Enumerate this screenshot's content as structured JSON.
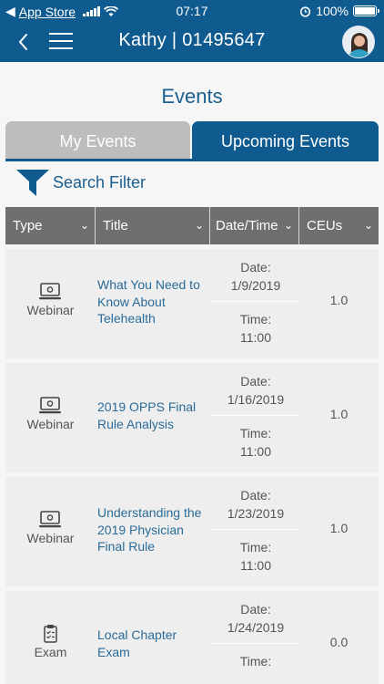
{
  "status_bar": {
    "carrier": "App Store",
    "time": "07:17",
    "battery": "100%"
  },
  "nav": {
    "title": "Kathy | 01495647"
  },
  "page": {
    "title": "Events"
  },
  "tabs": [
    {
      "label": "My Events",
      "active": false
    },
    {
      "label": "Upcoming Events",
      "active": true
    }
  ],
  "filter": {
    "label": "Search Filter"
  },
  "table": {
    "columns": [
      "Type",
      "Title",
      "Date/Time",
      "CEUs"
    ],
    "rows": [
      {
        "type": "Webinar",
        "icon": "webinar-icon",
        "title": "What You Need to Know About Telehealth",
        "date_label": "Date:",
        "date": "1/9/2019",
        "time_label": "Time:",
        "time": "11:00",
        "ceus": "1.0"
      },
      {
        "type": "Webinar",
        "icon": "webinar-icon",
        "title": "2019 OPPS Final Rule Analysis",
        "date_label": "Date:",
        "date": "1/16/2019",
        "time_label": "Time:",
        "time": "11:00",
        "ceus": "1.0"
      },
      {
        "type": "Webinar",
        "icon": "webinar-icon",
        "title": "Understanding the 2019 Physician Final Rule",
        "date_label": "Date:",
        "date": "1/23/2019",
        "time_label": "Time:",
        "time": "11:00",
        "ceus": "1.0"
      },
      {
        "type": "Exam",
        "icon": "exam-clipboard-icon",
        "title": "Local Chapter Exam",
        "date_label": "Date:",
        "date": "1/24/2019",
        "time_label": "Time:",
        "time": "",
        "ceus": "0.0"
      }
    ]
  },
  "colors": {
    "primary": "#0f5b8f",
    "inactive_tab": "#bdbdbd",
    "header_gray": "#6f6f6f",
    "row_bg": "#eeeeee",
    "link_text": "#2a6b98"
  }
}
